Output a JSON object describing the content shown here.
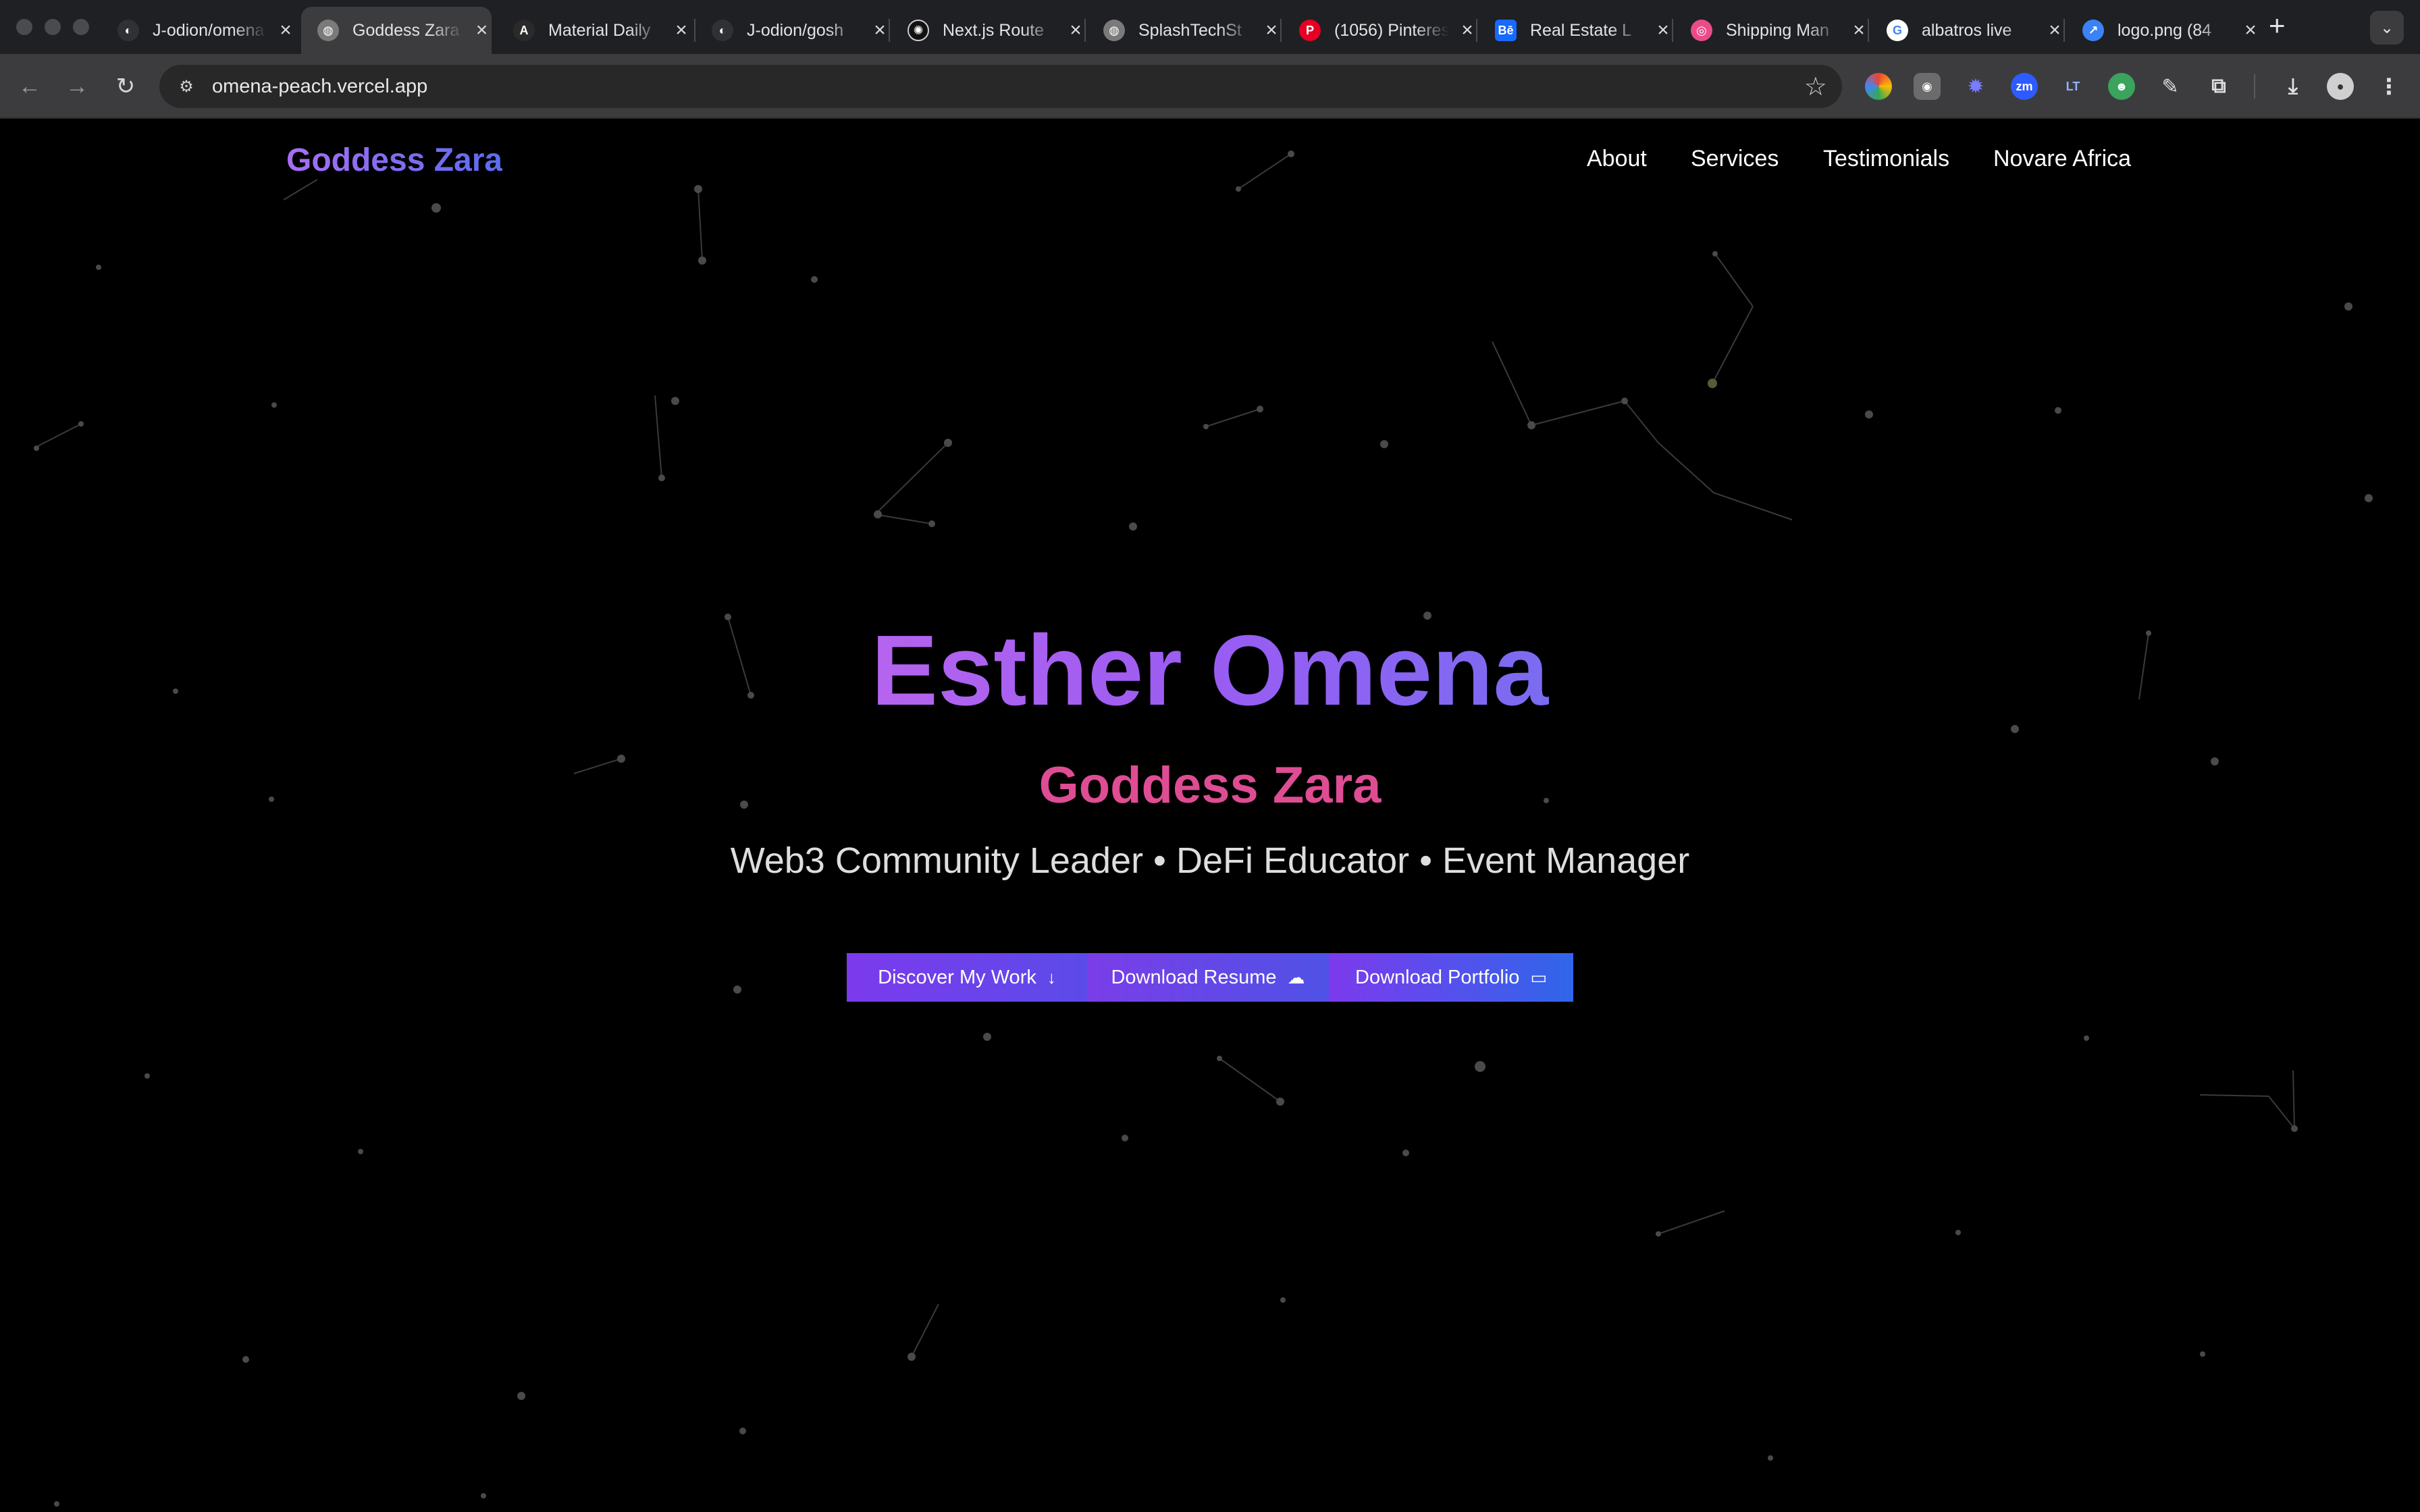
{
  "browser": {
    "tabs": [
      {
        "title": "J-odion/omena",
        "icon": "github-icon",
        "color": "#2f3137"
      },
      {
        "title": "Goddess Zara",
        "icon": "globe-icon",
        "color": "#7a7a7a",
        "active": true
      },
      {
        "title": "Material Daily",
        "icon": "material-icon",
        "color": "#2a2a2a"
      },
      {
        "title": "J-odion/gosh",
        "icon": "github-icon",
        "color": "#2f3137"
      },
      {
        "title": "Next.js Route",
        "icon": "openai-icon",
        "color": "#111111"
      },
      {
        "title": "SplashTechSt",
        "icon": "globe-icon",
        "color": "#7a7a7a"
      },
      {
        "title": "(1056) Pinterest",
        "icon": "pinterest-icon",
        "color": "#e60023"
      },
      {
        "title": "Real Estate L",
        "icon": "behance-icon",
        "color": "#1769ff"
      },
      {
        "title": "Shipping Man",
        "icon": "dribbble-icon",
        "color": "#ea4c89"
      },
      {
        "title": "albatros live",
        "icon": "google-icon",
        "color": "#ffffff"
      },
      {
        "title": "logo.png (84",
        "icon": "image-icon",
        "color": "#3b82f6"
      }
    ],
    "url": "omena-peach.vercel.app"
  },
  "nav": {
    "brand": "Goddess Zara",
    "links": [
      "About",
      "Services",
      "Testimonials",
      "Novare Africa"
    ]
  },
  "hero": {
    "name": "Esther Omena",
    "alias": "Goddess Zara",
    "roles": "Web3 Community Leader • DeFi Educator • Event Manager",
    "buttons": [
      {
        "label": "Discover My Work",
        "icon": "arrow-down-icon"
      },
      {
        "label": "Download Resume",
        "icon": "cloud-download-icon"
      },
      {
        "label": "Download Portfolio",
        "icon": "monitor-icon"
      }
    ]
  },
  "colors": {
    "accent_purple": "#7c3aed",
    "accent_blue": "#2563eb",
    "alias_pink": "#de4d93"
  }
}
